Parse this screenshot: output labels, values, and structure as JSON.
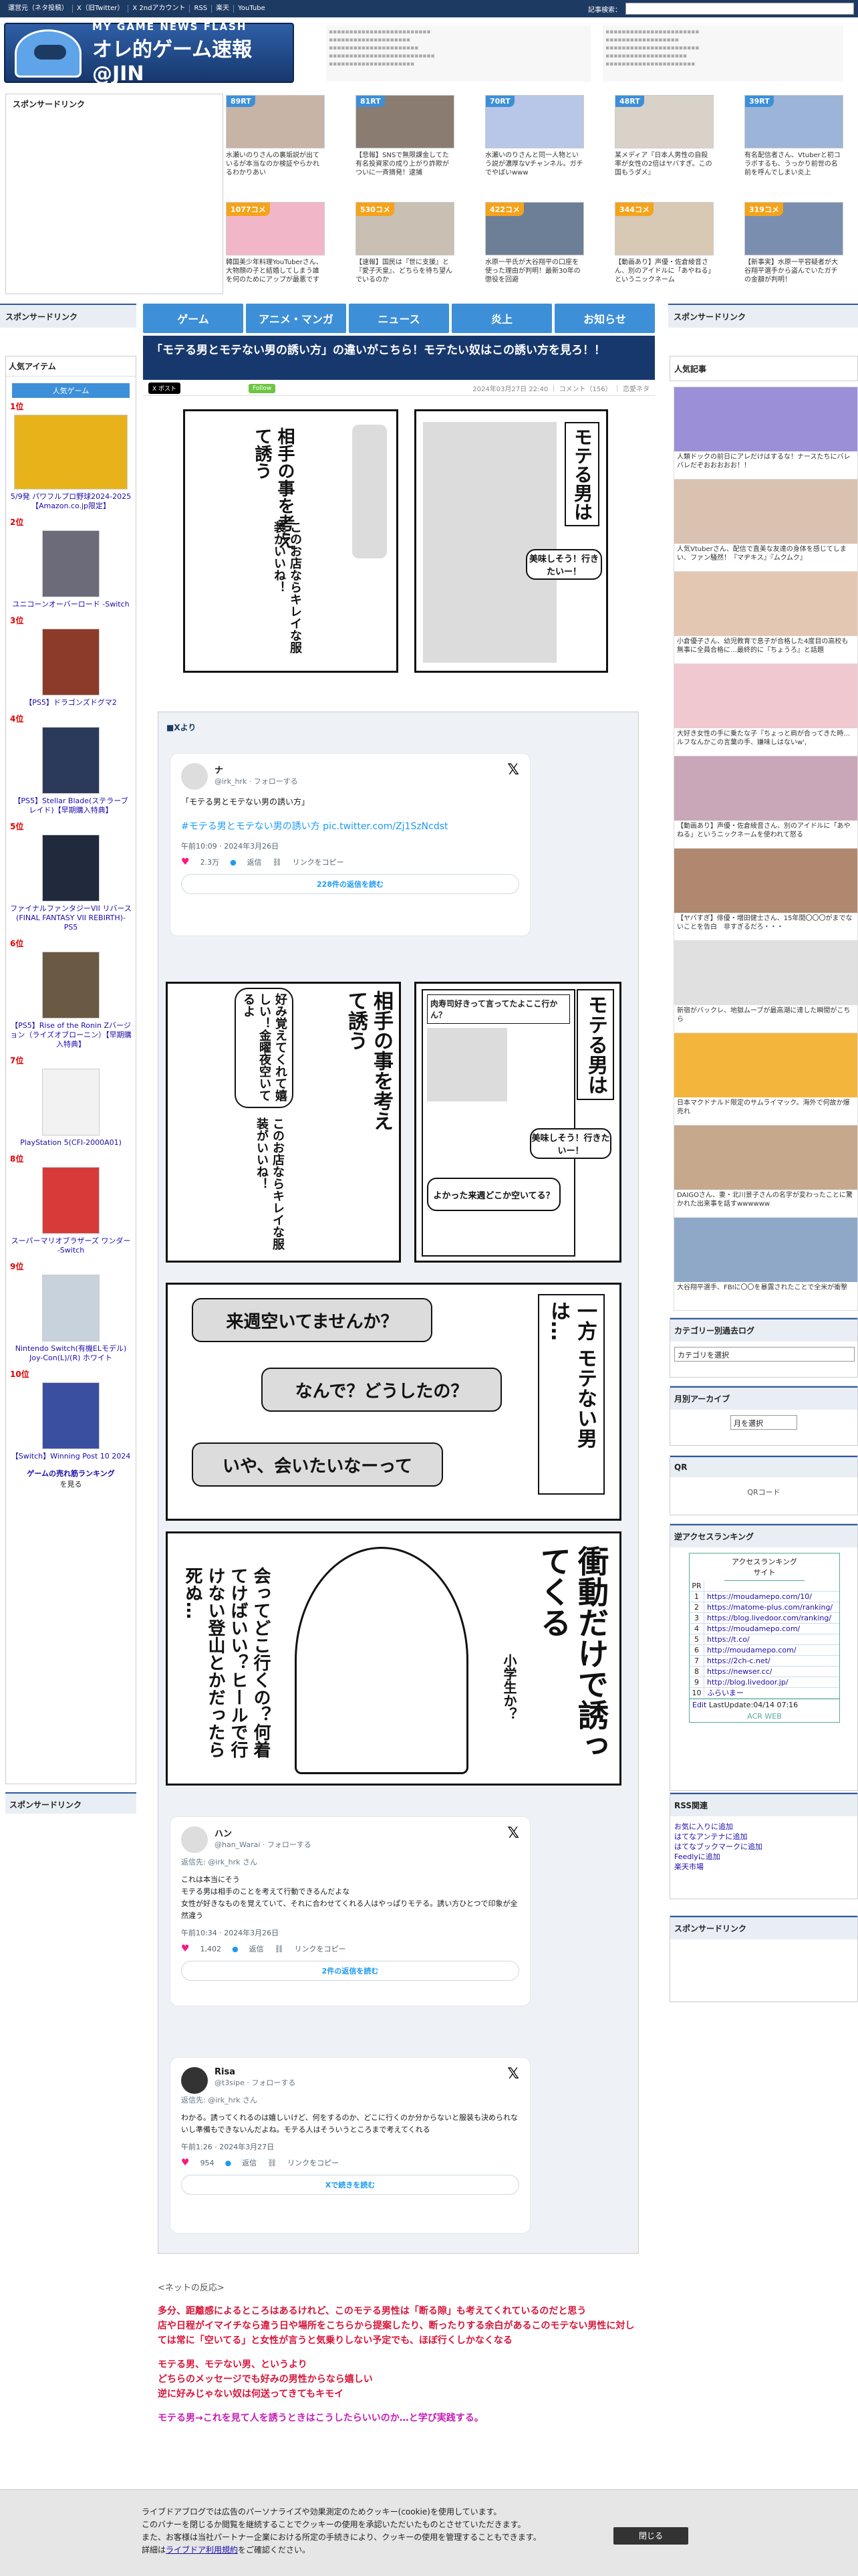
{
  "topbar": {
    "links": [
      "運営元（ネタ投稿）",
      "X（旧Twitter）",
      "X 2ndアカウント",
      "RSS",
      "楽天",
      "YouTube"
    ],
    "search_label": "記事検索："
  },
  "logo": {
    "line1": "MY GAME NEWS FLASH",
    "line2": "オレ的ゲーム速報@JIN"
  },
  "sponsor_label": "スポンサードリンク",
  "top_thumbs": [
    {
      "badge": "89RT",
      "caption": "水瀬いのりさんの裏垢説が出ているが本当なのか検証やらかれるわかりあい",
      "badge_color": "blue"
    },
    {
      "badge": "81RT",
      "caption": "【悲報】SNSで無限課金してた有名投資家の成り上がり詐欺がついに一斉摘発！逮捕",
      "badge_color": "blue"
    },
    {
      "badge": "70RT",
      "caption": "水瀬いのりさんと同一人物という説が濃厚なVチャンネル。ガチでやばいwww",
      "badge_color": "blue"
    },
    {
      "badge": "48RT",
      "caption": "某メディア『日本人男性の自殺率が女性の2倍はヤバすぎ。この国もうダメ』",
      "badge_color": "blue"
    },
    {
      "badge": "39RT",
      "caption": "有名配信者さん、Vtuberと初コラボするも、うっかり前世の名前を呼んでしまい炎上",
      "badge_color": "blue"
    },
    {
      "badge": "1077コメ",
      "caption": "韓国美少年料理YouTuberさん、大物顔の子と結婚してしまう誰を何のためにアップが最悪です",
      "badge_color": "orange"
    },
    {
      "badge": "530コメ",
      "caption": "【速報】国民は『世に支援』と『愛子天皇』、どちらを待ち望んでいるのか",
      "badge_color": "orange"
    },
    {
      "badge": "422コメ",
      "caption": "水原一平氏が大谷翔平の口座を使った理由が判明！最新30年の懲役を回避",
      "badge_color": "orange"
    },
    {
      "badge": "344コメ",
      "caption": "【動画あり】声優・佐倉綾音さん、別のアイドルに「あやねる」というニックネーム",
      "badge_color": "orange"
    },
    {
      "badge": "319コメ",
      "caption": "【新事実】水原一平容疑者が大谷翔平選手から盗んでいたガチの金額が判明！",
      "badge_color": "orange"
    }
  ],
  "nav": [
    "ゲーム",
    "アニメ・マンガ",
    "ニュース",
    "炎上",
    "お知らせ"
  ],
  "left_sidebar": {
    "sponsor": "スポンサードリンク",
    "popular_title": "人気アイテム",
    "popular_tab": "人気ゲーム",
    "items": [
      {
        "rank": "1位",
        "name": "5/9発 パワフルプロ野球2024-2025 【Amazon.co.jp限定】"
      },
      {
        "rank": "2位",
        "name": "ユニコーンオーバーロード -Switch"
      },
      {
        "rank": "3位",
        "name": "【PS5】ドラゴンズドグマ2"
      },
      {
        "rank": "4位",
        "name": "【PS5】Stellar Blade(ステラーブレイド)【早期購入特典】"
      },
      {
        "rank": "5位",
        "name": "ファイナルファンタジーVII リバース(FINAL FANTASY VII REBIRTH)-PS5"
      },
      {
        "rank": "6位",
        "name": "【PS5】Rise of the Ronin Zバージョン（ライズオブローニン）【早期購入特典】"
      },
      {
        "rank": "7位",
        "name": "PlayStation 5(CFI-2000A01)"
      },
      {
        "rank": "8位",
        "name": "スーパーマリオブラザーズ ワンダー -Switch"
      },
      {
        "rank": "9位",
        "name": "Nintendo Switch(有機ELモデル) Joy-Con(L)/(R) ホワイト"
      },
      {
        "rank": "10位",
        "name": "【Switch】Winning Post 10 2024"
      }
    ],
    "more_link": "ゲームの売れ筋ランキング",
    "more_suffix": "を見る",
    "sponsor2": "スポンサードリンク"
  },
  "article": {
    "title": "「モテる男とモテない男の誘い方」の違いがこちら！モテたい奴はこの誘い方を見ろ！！",
    "x_button": "X ポスト",
    "follow_button": "Follow",
    "meta": "2024年03月27日 22:40 ｜ コメント（156） ｜ 恋愛ネタ",
    "source_label": "■Xより"
  },
  "manga": {
    "p1_right": "モテる男は",
    "p1_bubble": "美味しそう！行きたいー！",
    "p1_left": "相手の事を考えて誘う",
    "p1_left2": "このお店ならキレイな服装がいいね！",
    "p2_text": "好み覚えてくれて嬉しい！金曜夜空いてるよ",
    "p2_right_title": "モテる男は",
    "p2_box": "肉寿司好きって言ってたよここ行かん？",
    "p2_bubble": "美味しそう！行きたいー！",
    "p2_bubble2": "よかった来週どこか空いてる？",
    "p3_right": "一方 モテない男は…",
    "p3_b1": "来週空いてませんか？",
    "p3_b2": "なんで？どうしたの？",
    "p3_b3": "いや、会いたいなーって",
    "p4_big": "衝動だけで誘ってくる",
    "p4_side": "小学生か？",
    "p4_text": "会ってどこ行くの？何着てけばいい？ヒールで行けない登山とかだったら死ぬ…"
  },
  "embeds": [
    {
      "name": "ナ",
      "handle": "@irk_hrk · フォローする",
      "body": "「モテる男とモテない男の誘い方」",
      "link": "#モテる男とモテない男の誘い方 pic.twitter.com/Zj1SzNcdst",
      "time": "午前10:09 · 2024年3月26日",
      "likes": "2.3万",
      "reply": "返信",
      "copy": "リンクをコピー",
      "more": "228件の返信を読む"
    },
    {
      "name": "ハン",
      "handle": "@han_Warai · フォローする",
      "sub": "返信先: @irk_hrk さん",
      "body": "これは本当にそう\nモテる男は相手のことを考えて行動できるんだよな\n女性が好きなものを覚えていて、それに合わせてくれる人はやっぱりモテる。誘い方ひとつで印象が全然違う",
      "time": "午前10:34 · 2024年3月26日",
      "likes": "1,402",
      "reply": "返信",
      "copy": "リンクをコピー",
      "more": "2件の返信を読む"
    },
    {
      "name": "Risa",
      "handle": "@t3sipe · フォローする",
      "sub": "返信先: @irk_hrk さん",
      "body": "わかる。誘ってくれるのは嬉しいけど、何をするのか、どこに行くのか分からないと服装も決められないし準備もできないんだよね。モテる人はそういうところまで考えてくれる",
      "time": "午前1:26 · 2024年3月27日",
      "likes": "954",
      "reply": "返信",
      "copy": "リンクをコピー",
      "more": "Xで続きを読む"
    }
  ],
  "reactions": {
    "label": "<ネットの反応>",
    "lines": [
      "多分、距離感によるところはあるけれど、このモテる男性は「断る隙」も考えてくれているのだと思う",
      "店や日程がイマイチなら違う日や場所をこちらから提案したり、断ったりする余白があるこのモテない男性に対しては常に「空いてる」と女性が言うと気乗りしない予定でも、ほぼ行くしかなくなる",
      "モテる男、モテない男、というより",
      "どちらのメッセージでも好みの男性からなら嬉しい",
      "逆に好みじゃない奴は何送ってきてもキモイ",
      "モテる男→これを見て人を誘うときはこうしたらいいのか…と学び実践する。"
    ]
  },
  "right_sidebar": {
    "sponsor": "スポンサードリンク",
    "popular_title": "人気記事",
    "articles": [
      "人類ドックの前日にアレだけはするな！ナースたちにバレバレだぞおおおおお！！",
      "人気Vtuberさん、配信で直美な友達の身体を感じてしまい、ファン騒然！『マヂキス』『ムクムク』",
      "小倉優子さん、幼児教育で息子が合格した4度目の高校も無事に全員合格に…最終的に『ちょうろ』と話題",
      "大好き女性の手に乗たな子『ちょっと肩が合ってきた時…ルフなんかこの言葉の手、嫌味しはないw',",
      "【動画あり】声優・佐倉綾音さん、別のアイドルに「あやねる」というニックネームを使われて怒る",
      "【ヤバすぎ】俳優・増田健士さん、15年間〇〇〇がまでないことを告白　非すぎるだろ・・・",
      "新宿がバックレ、地獄ムーブが最高潮に達した瞬間がこちら",
      "日本マクドナルド限定のサムライマック。海外で何故か爆売れ",
      "DAIGOさん、妻・北川景子さんの名字が変わったことに驚かれた出来事を話すwwwwww",
      "大谷翔平選手、FBIに〇〇を暴露されたことで全米が衝撃"
    ],
    "category_title": "カテゴリー別過去ログ",
    "category_select": "カテゴリを選択",
    "monthly_title": "月別アーカイブ",
    "monthly_select": "月を選択",
    "qr_title": "QR",
    "qr_alt": "QRコード",
    "access_title": "逆アクセスランキング",
    "access_table_title": "アクセスランキング サイト",
    "access_rows": [
      {
        "rank": "PR",
        "url": ""
      },
      {
        "rank": "1",
        "url": "https://moudamepo.com/10/"
      },
      {
        "rank": "2",
        "url": "https://matome-plus.com/ranking/"
      },
      {
        "rank": "3",
        "url": "https://blog.livedoor.com/ranking/"
      },
      {
        "rank": "4",
        "url": "https://moudamepo.com/"
      },
      {
        "rank": "5",
        "url": "https://t.co/"
      },
      {
        "rank": "6",
        "url": "http://moudamepo.com/"
      },
      {
        "rank": "7",
        "url": "https://2ch-c.net/"
      },
      {
        "rank": "8",
        "url": "https://newser.cc/"
      },
      {
        "rank": "9",
        "url": "http://blog.livedoor.jp/"
      },
      {
        "rank": "10",
        "url": "ふらいまー"
      }
    ],
    "access_footer": "LastUpdate:04/14 07:16",
    "access_footer_edit": "Edit",
    "access_footer2": "ACR WEB",
    "rss_title": "RSS関連",
    "rss_links": [
      "お気に入りに追加",
      "はてなアンテナに追加",
      "はてなブックマークに追加",
      "Feedlyに追加",
      "楽天市場"
    ],
    "sponsor2": "スポンサードリンク"
  },
  "cookie": {
    "line1": "ライブドアブログでは広告のパーソナライズや効果測定のためクッキー(cookie)を使用しています。",
    "line2": "このバナーを閉じるか閲覧を継続することでクッキーの使用を承認いただいたものとさせていただきます。",
    "line3": "また、お客様は当社パートナー企業における所定の手続きにより、クッキーの使用を管理することもできます。",
    "line4_pre": "詳細は",
    "line4_link": "ライブドア利用規約",
    "line4_post": "をご確認ください。",
    "close": "閉じる"
  },
  "colors": {
    "header_bg": "#1d3a63",
    "nav_bg": "#3d8fd8",
    "title_bg": "#17386d",
    "rank_red": "#dd0000",
    "reaction_red": "#d6163b",
    "reaction_pink": "#c51db7"
  }
}
